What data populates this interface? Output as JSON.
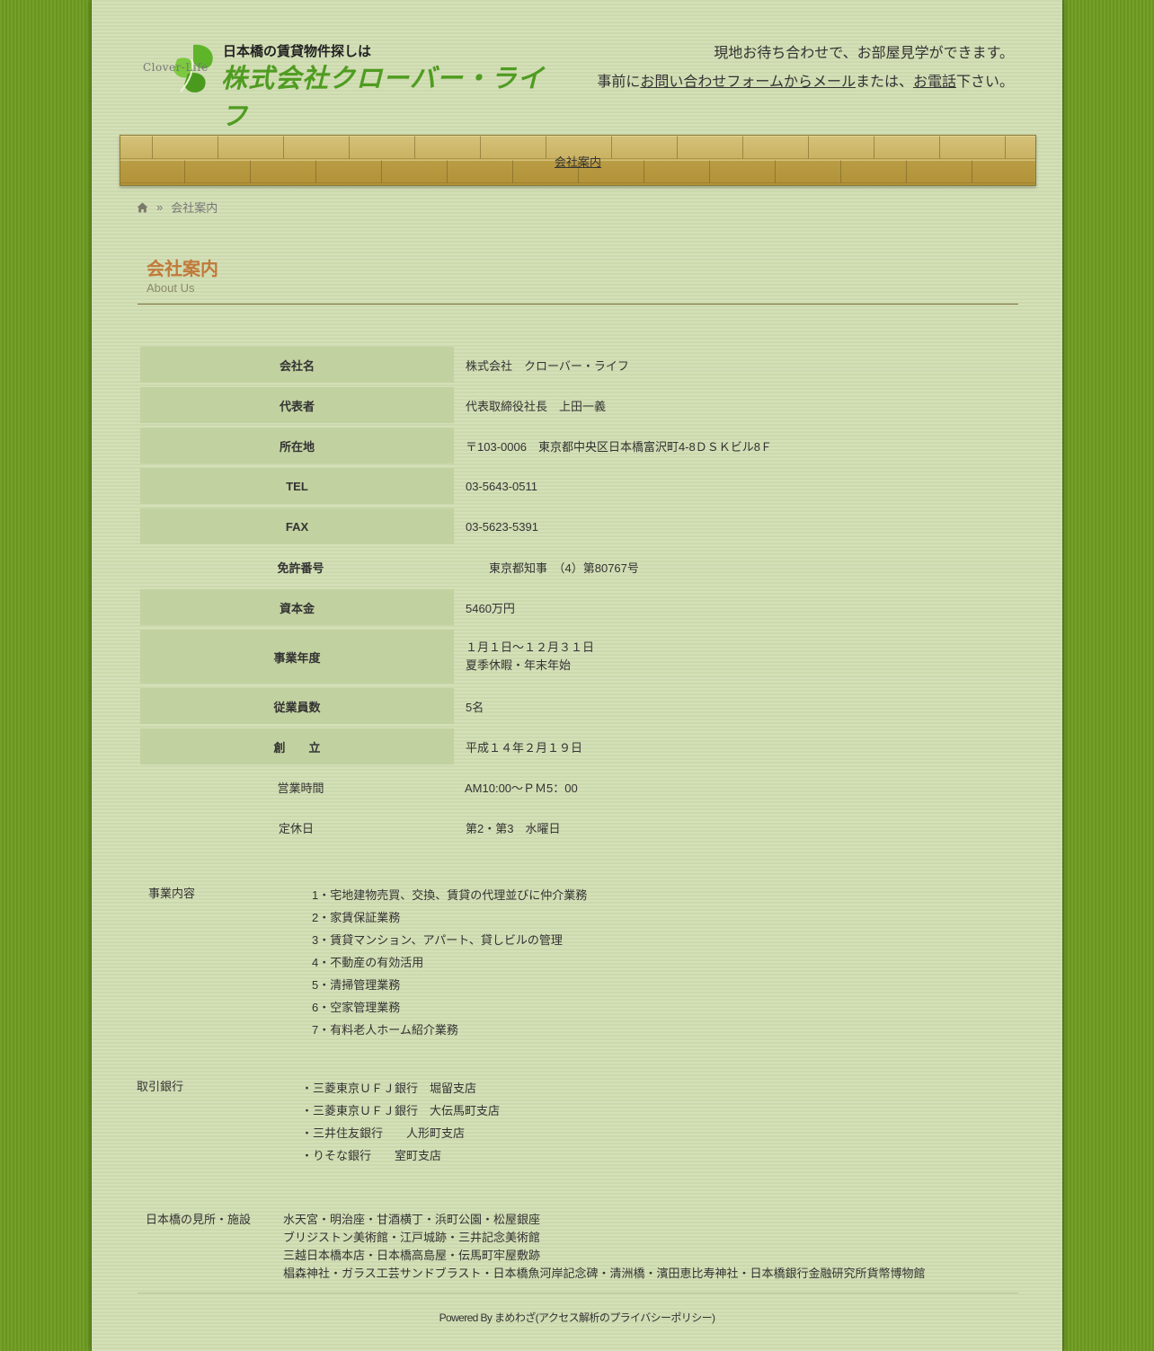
{
  "header": {
    "logo_en": "Clover-Life",
    "logo_tagline": "日本橋の賃貸物件探しは",
    "logo_name": "株式会社クローバー・ライフ",
    "msg_line1": "現地お待ち合わせで、お部屋見学ができます。",
    "msg_pre": "事前に",
    "msg_link1": "お問い合わせフォームからメール",
    "msg_mid": "または、",
    "msg_link2": "お電話",
    "msg_post": "下さい。"
  },
  "nav": {
    "item": "会社案内"
  },
  "breadcrumb": {
    "separator": "»",
    "current": "会社案内"
  },
  "page": {
    "title": "会社案内",
    "subtitle": "About Us"
  },
  "company": {
    "rows": [
      {
        "label": "会社名",
        "value": "株式会社　クローバー・ライフ"
      },
      {
        "label": "代表者",
        "value": "代表取締役社長　上田一義"
      },
      {
        "label": "所在地",
        "value": "〒103-0006　東京都中央区日本橋富沢町4-8ＤＳＫビル8Ｆ"
      },
      {
        "label": "TEL",
        "value": "03-5643-0511"
      },
      {
        "label": "FAX",
        "value": "03-5623-5391"
      },
      {
        "label": "免許番号",
        "value": "　　東京都知事　（4）第80767号"
      },
      {
        "label": "資本金",
        "value": "5460万円"
      },
      {
        "label": "事業年度",
        "value_line1": "１月１日～１２月３１日",
        "value_line2": "夏季休暇・年末年始"
      },
      {
        "label": "従業員数",
        "value": "5名"
      },
      {
        "label": "創　　立",
        "value": "平成１４年２月１９日"
      },
      {
        "label": "営業時間",
        "value": "AM10:00～ＰＭ5：00"
      },
      {
        "label": "定休日",
        "value": "第2・第3　水曜日"
      }
    ]
  },
  "business": {
    "label": "事業内容",
    "items": [
      "1・宅地建物売買、交換、賃貸の代理並びに仲介業務",
      "2・家賃保証業務",
      "3・賃貸マンション、アパート、貸しビルの管理",
      "4・不動産の有効活用",
      "5・清掃管理業務",
      "6・空家管理業務",
      "7・有料老人ホーム紹介業務"
    ]
  },
  "banks": {
    "label": "取引銀行",
    "items": [
      "・三菱東京ＵＦＪ銀行　堀留支店",
      "・三菱東京ＵＦＪ銀行　大伝馬町支店",
      "・三井住友銀行　　人形町支店",
      "・りそな銀行　　室町支店"
    ]
  },
  "sights": {
    "label": "日本橋の見所・施設",
    "items": [
      "水天宮・明治座・甘酒横丁・浜町公園・松屋銀座",
      "ブリジストン美術館・江戸城跡・三井記念美術館",
      "三越日本橋本店・日本橋高島屋・伝馬町牢屋敷跡",
      "椙森神社・ガラス工芸サンドブラスト・日本橋魚河岸記念碑・清洲橋・濱田恵比寿神社・日本橋銀行金融研究所貨幣博物館"
    ]
  },
  "footer": {
    "powered": "Powered By ",
    "link": "まめわざ(アクセス解析のプライバシーポリシー)"
  },
  "colors": {
    "accent_title": "#c07a3a",
    "logo_green": "#4f9c21",
    "page_bg": "#cfdcb0",
    "body_bg": "#6d9b20"
  }
}
